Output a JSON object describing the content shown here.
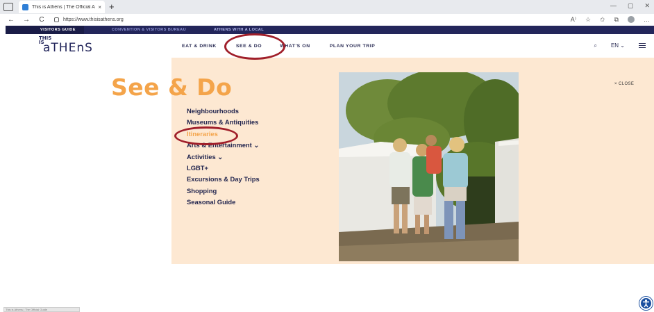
{
  "browser": {
    "tab_title": "This is Athens | The Official Athe",
    "tab_close": "×",
    "new_tab": "+",
    "url": "https://www.thisisathens.org",
    "window_controls": {
      "minimize": "—",
      "restore": "▢",
      "close": "✕"
    },
    "nav": {
      "back": "←",
      "forward": "→",
      "reload": "C"
    },
    "toolbar_icons": [
      "read-aloud-icon",
      "favorite-icon",
      "favorites-icon",
      "collections-icon",
      "profile-icon",
      "more-icon"
    ],
    "toolbar_glyphs": {
      "read_aloud": "A⁾",
      "favorite": "☆",
      "favorites": "✩",
      "collections": "⧉",
      "more": "…"
    }
  },
  "top_strip": {
    "items": [
      "VISITORS GUIDE",
      "CONVENTION & VISITORS BUREAU",
      "ATHENS WITH A LOCAL"
    ]
  },
  "header": {
    "logo_small": "THIS\nIS",
    "logo_big": "aTHEnS",
    "nav": [
      "EAT & DRINK",
      "SEE & DO",
      "WHAT'S ON",
      "PLAN YOUR TRIP"
    ],
    "search_icon": "⌕",
    "language": "EN ⌄"
  },
  "mega_menu": {
    "title": "See & Do",
    "close_label": "× CLOSE",
    "items": [
      "Neighbourhoods",
      "Museums & Antiquities",
      "Itineraries",
      "Arts & Entertainment ⌄",
      "Activities ⌄",
      "LGBT+",
      "Excursions & Day Trips",
      "Shopping",
      "Seasonal Guide"
    ],
    "highlighted_item": "Itineraries"
  },
  "status_bar": "This is Athens | The Official Guide",
  "colors": {
    "navy": "#23265b",
    "accent_orange": "#f4a44a",
    "menu_bg": "#fde8d2",
    "annotation_red": "#a01f2a"
  }
}
